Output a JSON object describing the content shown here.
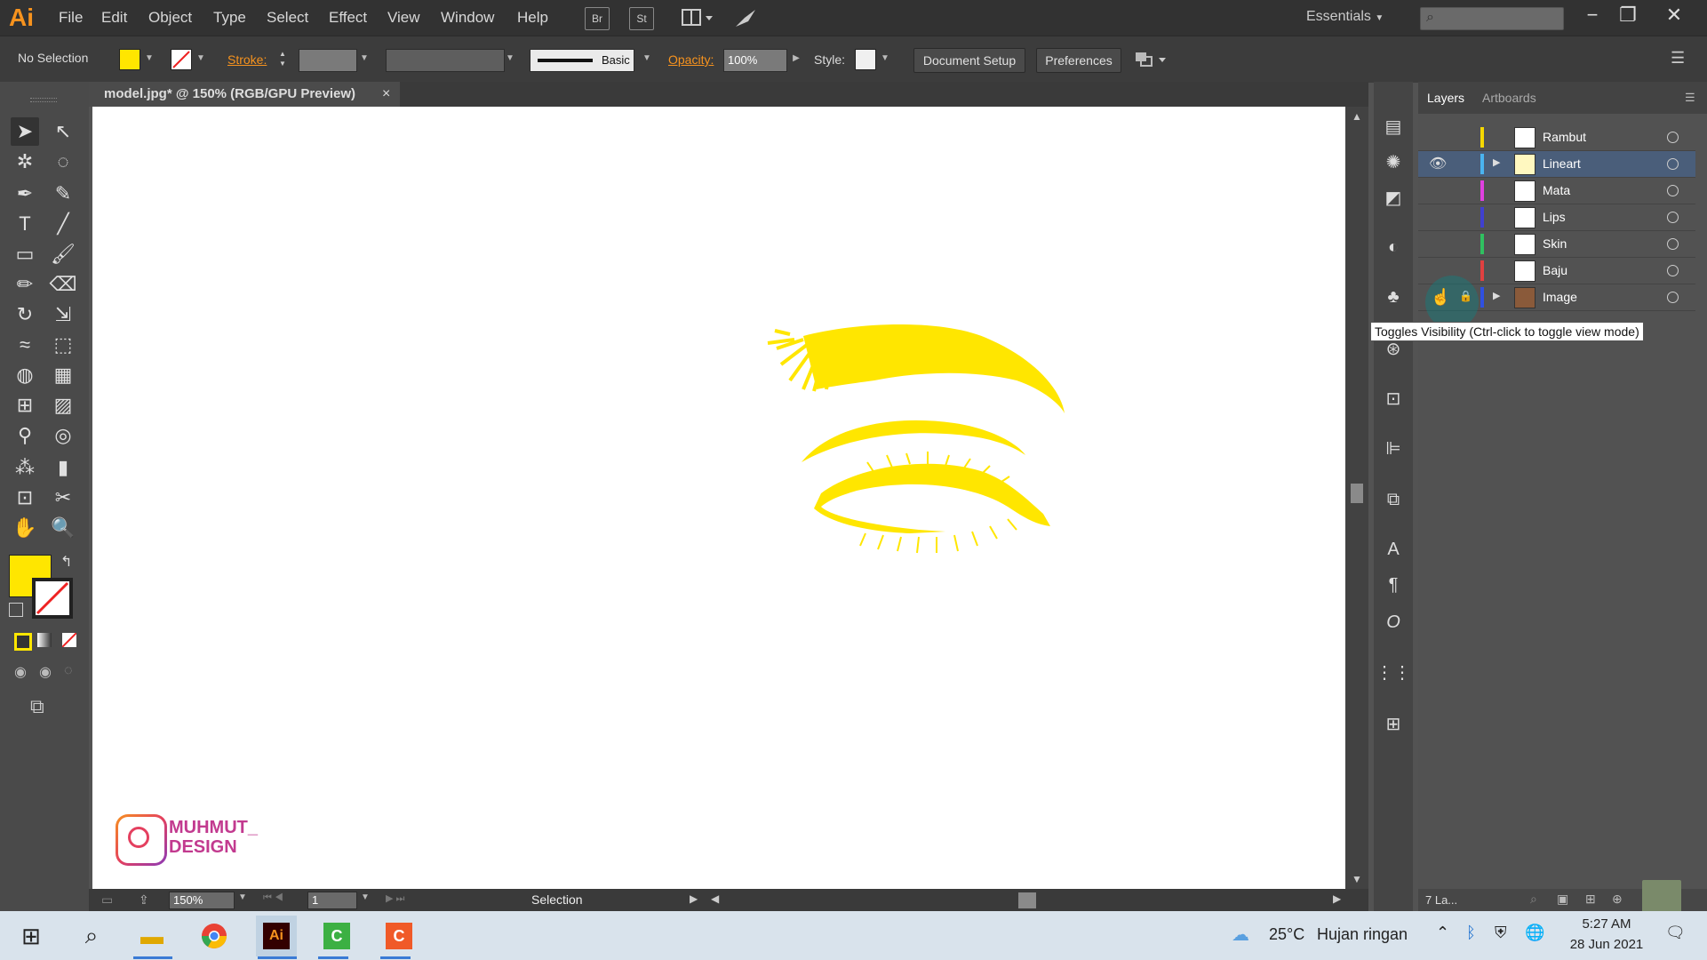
{
  "app": {
    "logo": "Ai"
  },
  "menu": [
    "File",
    "Edit",
    "Object",
    "Type",
    "Select",
    "Effect",
    "View",
    "Window",
    "Help"
  ],
  "menu_icons": {
    "bridge": "Br",
    "stock": "St"
  },
  "workspace": "Essentials",
  "control_bar": {
    "selection": "No Selection",
    "stroke_label": "Stroke:",
    "stroke_profile": "Basic",
    "opacity_label": "Opacity:",
    "opacity_value": "100%",
    "style_label": "Style:",
    "document_setup": "Document Setup",
    "preferences": "Preferences"
  },
  "document_tab": {
    "title": "model.jpg* @ 150% (RGB/GPU Preview)",
    "close": "×"
  },
  "panel_tabs": [
    "Layers",
    "Artboards"
  ],
  "layers": [
    {
      "name": "Rambut",
      "color": "#f5d800",
      "visible": false,
      "locked": false,
      "expandable": false
    },
    {
      "name": "Lineart",
      "color": "#4ab4f0",
      "visible": true,
      "locked": false,
      "expandable": true,
      "selected": true
    },
    {
      "name": "Mata",
      "color": "#e040e0",
      "visible": false,
      "locked": false,
      "expandable": false
    },
    {
      "name": "Lips",
      "color": "#4040d0",
      "visible": false,
      "locked": false,
      "expandable": false
    },
    {
      "name": "Skin",
      "color": "#30c060",
      "visible": false,
      "locked": false,
      "expandable": false
    },
    {
      "name": "Baju",
      "color": "#e04040",
      "visible": false,
      "locked": false,
      "expandable": false
    },
    {
      "name": "Image",
      "color": "#3050e0",
      "visible": false,
      "locked": true,
      "expandable": true
    }
  ],
  "tooltip": "Toggles Visibility (Ctrl-click to toggle view mode)",
  "layer_count": "7 La...",
  "status_bar": {
    "zoom": "150%",
    "artboard": "1",
    "tool": "Selection"
  },
  "watermark": {
    "line1": "MUHMUT_",
    "line2": "DESIGN"
  },
  "colors": {
    "fill": "#ffe600",
    "artwork": "#ffe600",
    "accent": "#f7931e"
  },
  "taskbar": {
    "temperature": "25°C",
    "weather": "Hujan ringan",
    "time": "5:27 AM",
    "date": "28 Jun 2021"
  }
}
